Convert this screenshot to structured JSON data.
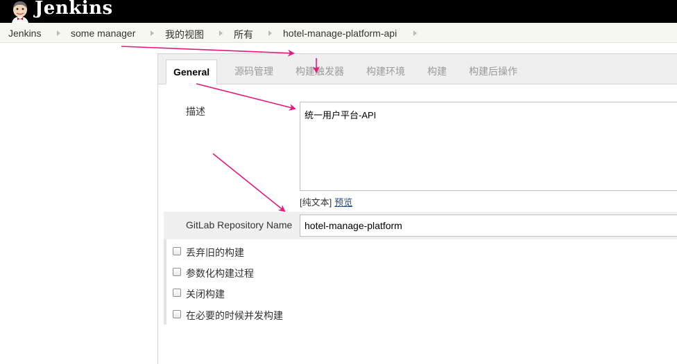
{
  "header": {
    "title": "Jenkins",
    "logo_icon": "jenkins-butler-icon"
  },
  "breadcrumb": [
    {
      "label": "Jenkins"
    },
    {
      "label": "some manager"
    },
    {
      "label": "我的视图"
    },
    {
      "label": "所有"
    },
    {
      "label": "hotel-manage-platform-api"
    }
  ],
  "tabs": [
    {
      "label": "General",
      "active": true
    },
    {
      "label": "源码管理",
      "active": false
    },
    {
      "label": "构建触发器",
      "active": false
    },
    {
      "label": "构建环境",
      "active": false
    },
    {
      "label": "构建",
      "active": false
    },
    {
      "label": "构建后操作",
      "active": false
    }
  ],
  "form": {
    "description": {
      "label": "描述",
      "value": "统一用户平台-API",
      "plain_text_label": "[纯文本]",
      "preview_label": "预览"
    },
    "gitlab": {
      "label": "GitLab Repository Name",
      "value": "hotel-manage-platform"
    },
    "options": [
      {
        "label": "丢弃旧的构建",
        "checked": false
      },
      {
        "label": "参数化构建过程",
        "checked": false
      },
      {
        "label": "关闭构建",
        "checked": false
      },
      {
        "label": "在必要的时候并发构建",
        "checked": false
      }
    ]
  },
  "colors": {
    "annotation_arrow": "#e8177d",
    "header_bg": "#000000",
    "link": "#204a87"
  }
}
